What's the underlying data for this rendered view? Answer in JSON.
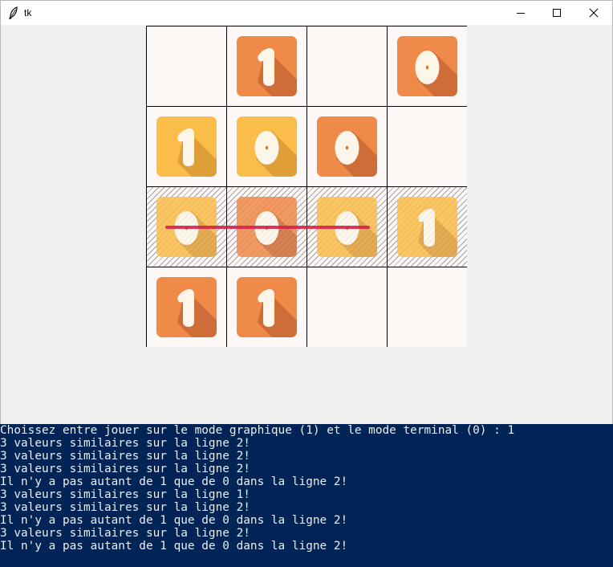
{
  "window": {
    "title": "tk"
  },
  "controls": {
    "minimize": "minimize",
    "maximize": "maximize",
    "close": "close"
  },
  "board": {
    "highlighted_row": 2,
    "cells": [
      [
        {
          "value": "",
          "color": ""
        },
        {
          "value": "1",
          "color": "orange"
        },
        {
          "value": "",
          "color": ""
        },
        {
          "value": "0",
          "color": "orange"
        }
      ],
      [
        {
          "value": "1",
          "color": "yellow"
        },
        {
          "value": "0",
          "color": "yellow"
        },
        {
          "value": "0",
          "color": "orange"
        },
        {
          "value": "",
          "color": ""
        }
      ],
      [
        {
          "value": "0",
          "color": "yellow"
        },
        {
          "value": "0",
          "color": "orange"
        },
        {
          "value": "0",
          "color": "yellow"
        },
        {
          "value": "1",
          "color": "yellow"
        }
      ],
      [
        {
          "value": "1",
          "color": "orange"
        },
        {
          "value": "1",
          "color": "orange"
        },
        {
          "value": "",
          "color": ""
        },
        {
          "value": "",
          "color": ""
        }
      ]
    ],
    "colors": {
      "orange": "#f08a48",
      "yellow": "#fbbd4a",
      "strike": "#d4214a"
    }
  },
  "terminal": {
    "lines": [
      "Choissez entre jouer sur le mode graphique (1) et le mode terminal (0) : 1",
      "3 valeurs similaires sur la ligne 2!",
      "3 valeurs similaires sur la ligne 2!",
      "3 valeurs similaires sur la ligne 2!",
      "Il n'y a pas autant de 1 que de 0 dans la ligne 2!",
      "3 valeurs similaires sur la ligne 1!",
      "3 valeurs similaires sur la ligne 2!",
      "Il n'y a pas autant de 1 que de 0 dans la ligne 2!",
      "3 valeurs similaires sur la ligne 2!",
      "Il n'y a pas autant de 1 que de 0 dans la ligne 2!"
    ]
  }
}
